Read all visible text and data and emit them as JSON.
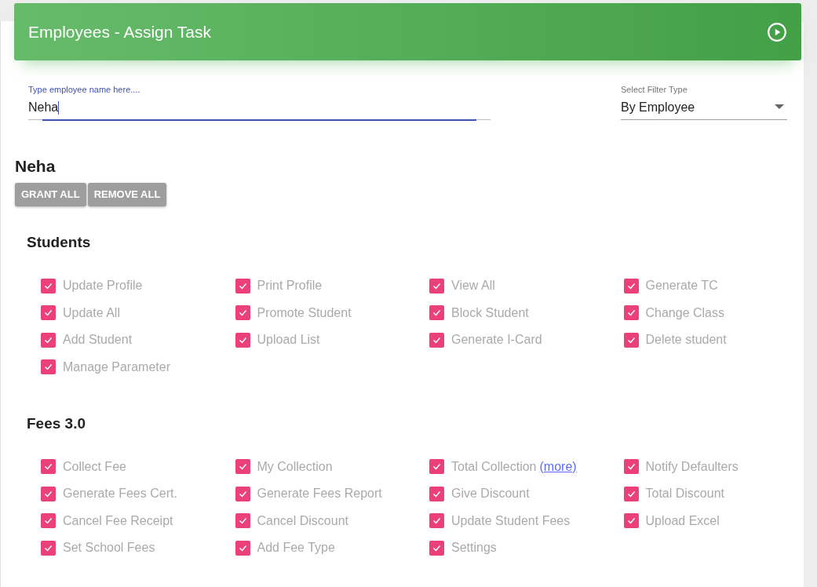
{
  "header": {
    "title": "Employees - Assign Task"
  },
  "employee_field": {
    "label": "Type employee name here....",
    "value": "Neha"
  },
  "filter_select": {
    "label": "Select Filter Type",
    "value": "By Employee"
  },
  "employee_name": "Neha",
  "buttons": [
    "GRANT ALL",
    "REMOVE ALL"
  ],
  "sections": [
    {
      "title": "Students",
      "items": [
        {
          "label": "Update Profile",
          "checked": true
        },
        {
          "label": "Print Profile",
          "checked": true
        },
        {
          "label": "View All",
          "checked": true
        },
        {
          "label": "Generate TC",
          "checked": true
        },
        {
          "label": "Update All",
          "checked": true
        },
        {
          "label": "Promote Student",
          "checked": true
        },
        {
          "label": "Block Student",
          "checked": true
        },
        {
          "label": "Change Class",
          "checked": true
        },
        {
          "label": "Add Student",
          "checked": true
        },
        {
          "label": "Upload List",
          "checked": true
        },
        {
          "label": "Generate I-Card",
          "checked": true
        },
        {
          "label": "Delete student",
          "checked": true
        },
        {
          "label": "Manage Parameter",
          "checked": true
        }
      ]
    },
    {
      "title": "Fees 3.0",
      "items": [
        {
          "label": "Collect Fee",
          "checked": true
        },
        {
          "label": "My Collection",
          "checked": true
        },
        {
          "label": "Total Collection",
          "checked": true,
          "link": "(more)"
        },
        {
          "label": "Notify Defaulters",
          "checked": true
        },
        {
          "label": "Generate Fees Cert.",
          "checked": true
        },
        {
          "label": "Generate Fees Report",
          "checked": true
        },
        {
          "label": "Give Discount",
          "checked": true
        },
        {
          "label": "Total Discount",
          "checked": true
        },
        {
          "label": "Cancel Fee Receipt",
          "checked": true
        },
        {
          "label": "Cancel Discount",
          "checked": true
        },
        {
          "label": "Update Student Fees",
          "checked": true
        },
        {
          "label": "Upload Excel",
          "checked": true
        },
        {
          "label": "Set School Fees",
          "checked": true
        },
        {
          "label": "Add Fee Type",
          "checked": true
        },
        {
          "label": "Settings",
          "checked": true
        }
      ]
    }
  ]
}
